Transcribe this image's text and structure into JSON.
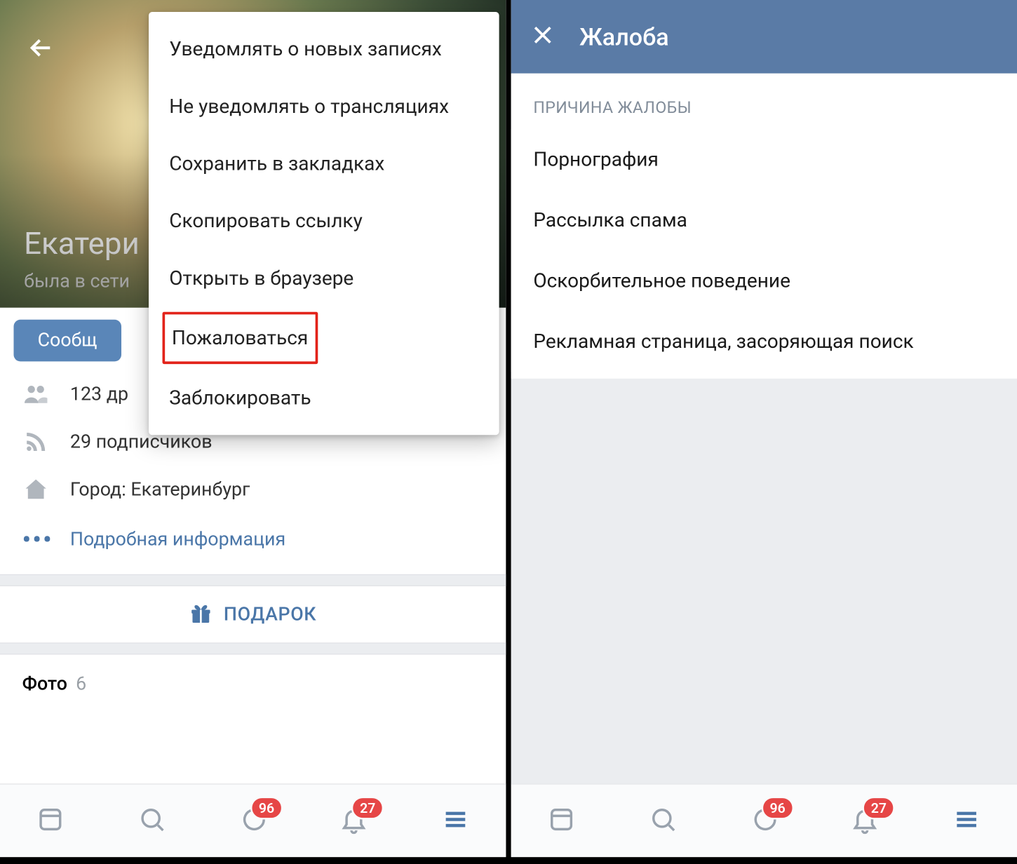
{
  "left": {
    "profile_name": "Екатери",
    "status": "была в сети",
    "message_button": "Сообщ",
    "friends_text": "123 др",
    "followers_text": "29 подписчиков",
    "city_text": "Город: Екатеринбург",
    "more_info": "Подробная информация",
    "gift_label": "ПОДАРОК",
    "photos_label": "Фото",
    "photos_count": "6"
  },
  "menu": {
    "items": [
      "Уведомлять о новых записях",
      "Не уведомлять о трансляциях",
      "Сохранить в закладках",
      "Скопировать ссылку",
      "Открыть в браузере",
      "Пожаловаться",
      "Заблокировать"
    ]
  },
  "right": {
    "title": "Жалоба",
    "section": "ПРИЧИНА ЖАЛОБЫ",
    "reasons": [
      "Порнография",
      "Рассылка спама",
      "Оскорбительное поведение",
      "Рекламная страница, засоряющая поиск"
    ]
  },
  "nav": {
    "badge_messages": "96",
    "badge_notifications": "27"
  }
}
